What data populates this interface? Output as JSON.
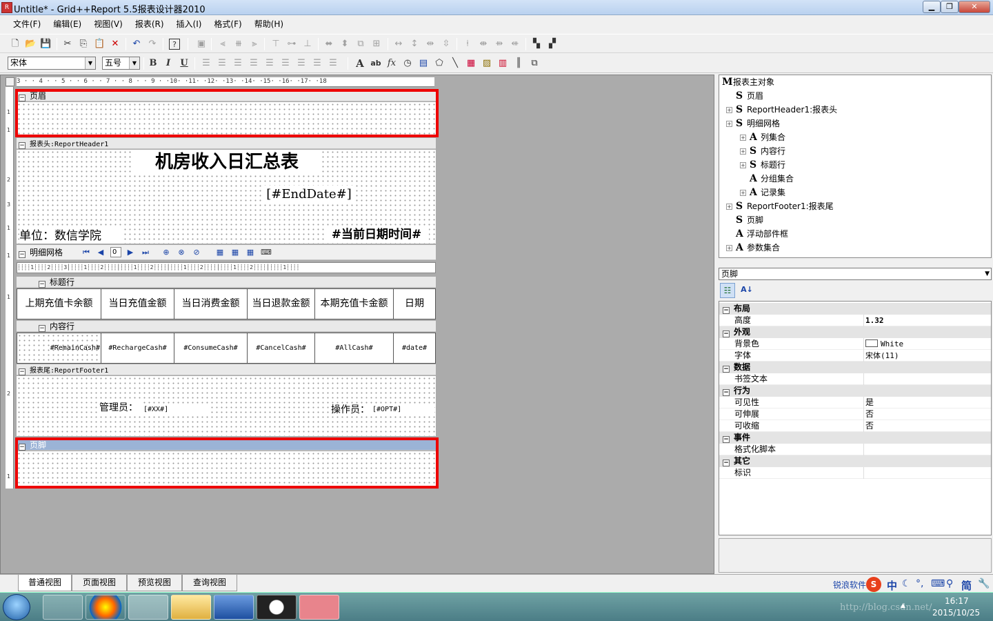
{
  "window": {
    "title": "Untitle* - Grid++Report 5.5报表设计器2010"
  },
  "menu": [
    "文件(F)",
    "编辑(E)",
    "视图(V)",
    "报表(R)",
    "插入(I)",
    "格式(F)",
    "帮助(H)"
  ],
  "format_toolbar": {
    "font": "宋体",
    "size": "五号",
    "bold": "B",
    "italic": "I",
    "underline": "U"
  },
  "ruler": {
    "h_labels": "3 · · 4 · · 5 · · 6 · · 7 · · 8 · · 9 · ·10· ·11· ·12· ·13· ·14· ·15· ·16· ·17· ·18",
    "v_labels": [
      "1",
      "1",
      "2",
      "3",
      "1",
      "1",
      "1",
      "2",
      "1"
    ]
  },
  "design": {
    "page_header_band": "页眉",
    "report_header_band": "报表头:ReportHeader1",
    "report_title": "机房收入日汇总表",
    "end_date_field": "[#EndDate#]",
    "unit_label": "单位：数信学院",
    "current_datetime": "#当前日期时间#",
    "detail_grid_band": "明细网格",
    "nav_page_value": "0",
    "title_row_band": "标题行",
    "columns": [
      "上期充值卡余额",
      "当日充值金额",
      "当日消费金额",
      "当日退款金额",
      "本期充值卡金额",
      "日期"
    ],
    "content_row_band": "内容行",
    "cells": [
      "#RemainCash#",
      "#RechargeCash#",
      "#ConsumeCash#",
      "#CancelCash#",
      "#AllCash#",
      "#date#"
    ],
    "report_footer_band": "报表尾:ReportFooter1",
    "manager_label": "管理员：",
    "manager_field": "[#XX#]",
    "operator_label": "操作员：",
    "operator_field": "[#OPT#]",
    "page_footer_band": "页脚"
  },
  "tree": [
    {
      "glyph": "M",
      "label": "报表主对象",
      "level": 0,
      "plus": false
    },
    {
      "glyph": "S",
      "label": "页眉",
      "level": 1,
      "plus": false
    },
    {
      "glyph": "S",
      "label": "ReportHeader1:报表头",
      "level": 1,
      "plus": true
    },
    {
      "glyph": "S",
      "label": "明细网格",
      "level": 1,
      "plus": true
    },
    {
      "glyph": "A",
      "label": "列集合",
      "level": 2,
      "plus": true
    },
    {
      "glyph": "S",
      "label": "内容行",
      "level": 2,
      "plus": true
    },
    {
      "glyph": "S",
      "label": "标题行",
      "level": 2,
      "plus": true
    },
    {
      "glyph": "A",
      "label": "分组集合",
      "level": 2,
      "plus": false
    },
    {
      "glyph": "A",
      "label": "记录集",
      "level": 2,
      "plus": true
    },
    {
      "glyph": "S",
      "label": "ReportFooter1:报表尾",
      "level": 1,
      "plus": true
    },
    {
      "glyph": "S",
      "label": "页脚",
      "level": 1,
      "plus": false
    },
    {
      "glyph": "A",
      "label": "浮动部件框",
      "level": 1,
      "plus": false
    },
    {
      "glyph": "A",
      "label": "参数集合",
      "level": 1,
      "plus": true
    }
  ],
  "properties": {
    "selected_object": "页脚",
    "groups": [
      {
        "name": "布局",
        "rows": [
          {
            "name": "高度",
            "value": "1.32"
          }
        ]
      },
      {
        "name": "外观",
        "rows": [
          {
            "name": "背景色",
            "value": "White"
          },
          {
            "name": "字体",
            "value": "宋体(11)"
          }
        ]
      },
      {
        "name": "数据",
        "rows": [
          {
            "name": "书签文本",
            "value": ""
          }
        ]
      },
      {
        "name": "行为",
        "rows": [
          {
            "name": "可见性",
            "value": "是"
          },
          {
            "name": "可伸展",
            "value": "否"
          },
          {
            "name": "可收缩",
            "value": "否"
          }
        ]
      },
      {
        "name": "事件",
        "rows": [
          {
            "name": "格式化脚本",
            "value": ""
          }
        ]
      },
      {
        "name": "其它",
        "rows": [
          {
            "name": "标识",
            "value": ""
          }
        ]
      }
    ]
  },
  "view_tabs": [
    "普通视图",
    "页面视图",
    "预览视图",
    "查询视图"
  ],
  "tray": {
    "brand": "锐浪软件",
    "ime": "中",
    "ime_simplified": "简",
    "time": "16:17",
    "date": "2015/10/25",
    "watermark": "http://blog.csdn.net/"
  },
  "colors": {
    "highlight_box": "#e00000",
    "selected_band": "#9bb3d6",
    "design_background": "#ababab"
  }
}
